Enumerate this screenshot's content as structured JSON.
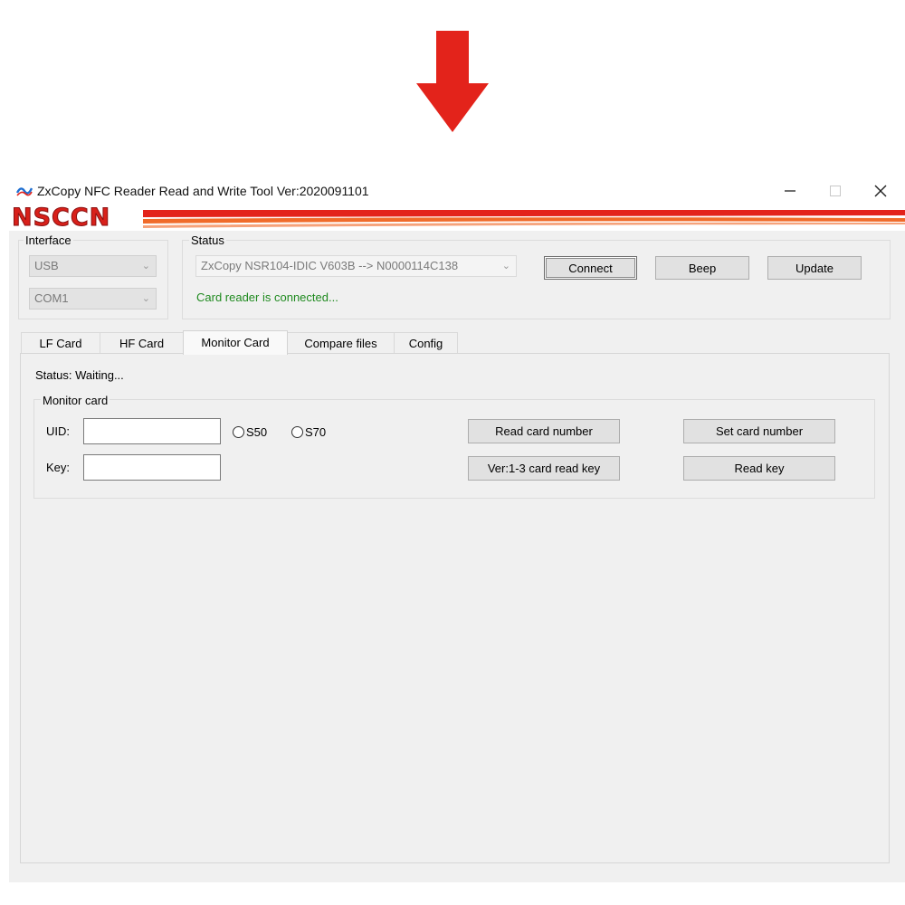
{
  "window": {
    "title": "ZxCopy NFC Reader Read and Write Tool  Ver:2020091101",
    "logo_text": "NSCCN"
  },
  "interface": {
    "label": "Interface",
    "type_value": "USB",
    "port_value": "COM1"
  },
  "status": {
    "label": "Status",
    "device_value": "ZxCopy NSR104-IDIC V603B --> N0000114C138",
    "message": "Card reader is connected...",
    "connect_label": "Connect",
    "beep_label": "Beep",
    "update_label": "Update"
  },
  "tabs": [
    {
      "label": "LF Card"
    },
    {
      "label": "HF Card"
    },
    {
      "label": "Monitor Card"
    },
    {
      "label": "Compare files"
    },
    {
      "label": "Config"
    }
  ],
  "monitor": {
    "status_text": "Status: Waiting...",
    "group_label": "Monitor card",
    "uid_label": "UID:",
    "key_label": "Key:",
    "uid_value": "",
    "key_value": "",
    "s50_label": "S50",
    "s70_label": "S70",
    "read_card_number_label": "Read card number",
    "set_card_number_label": "Set card number",
    "read_key_ver_label": "Ver:1-3 card read key",
    "read_key_label": "Read key"
  },
  "colors": {
    "accent_red": "#e3231b",
    "status_green": "#1f8a1f",
    "window_bg": "#f0f0f0"
  }
}
